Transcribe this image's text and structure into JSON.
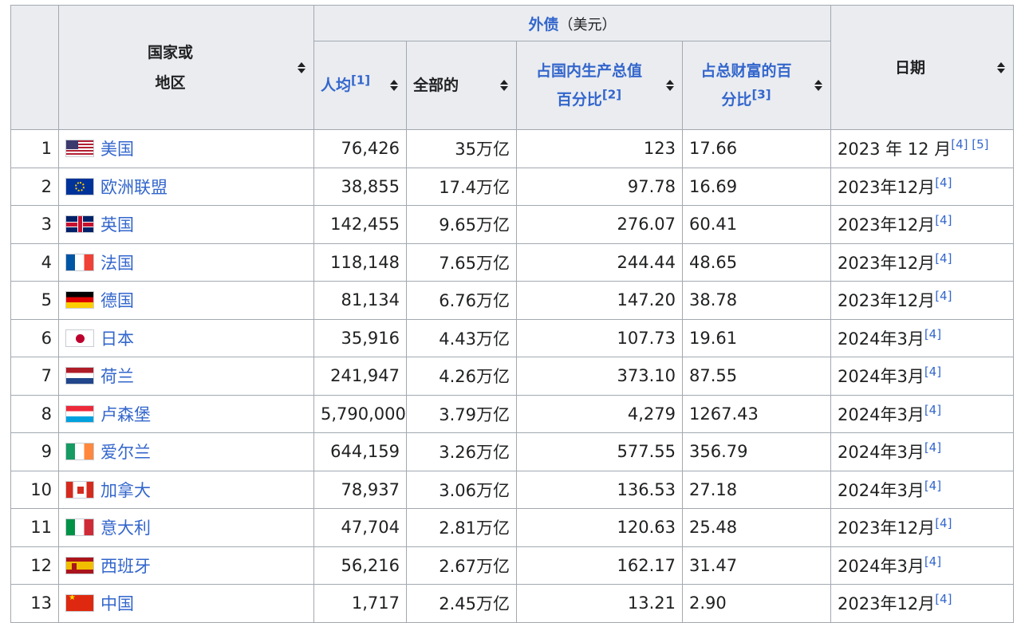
{
  "table": {
    "headers": {
      "country": "国家或\n地区",
      "country_line1": "国家或",
      "country_line2": "地区",
      "group_title": "外债",
      "group_unit": "（美元）",
      "per_capita": "人均",
      "per_capita_ref": "[1]",
      "total": "全部的",
      "gdp_pct_line1": "占国内生产总值",
      "gdp_pct_line2": "百分比",
      "gdp_pct_ref": "[2]",
      "wealth_pct_line1": "占总财富的百",
      "wealth_pct_line2": "分比",
      "wealth_pct_ref": "[3]",
      "date": "日期"
    },
    "rows": [
      {
        "rank": "1",
        "flag": "us-flag",
        "country": "美国",
        "per_capita": "76,426",
        "total": "35万亿",
        "gdp_pct": "123",
        "wealth_pct": "17.66",
        "date": "2023 年 12 月",
        "refs": "[4] [5]"
      },
      {
        "rank": "2",
        "flag": "eu-flag",
        "country": "欧洲联盟",
        "per_capita": "38,855",
        "total": "17.4万亿",
        "gdp_pct": "97.78",
        "wealth_pct": "16.69",
        "date": "2023年12月",
        "refs": "[4]"
      },
      {
        "rank": "3",
        "flag": "uk-flag",
        "country": "英国",
        "per_capita": "142,455",
        "total": "9.65万亿",
        "gdp_pct": "276.07",
        "wealth_pct": "60.41",
        "date": "2023年12月",
        "refs": "[4]"
      },
      {
        "rank": "4",
        "flag": "france-flag",
        "country": "法国",
        "per_capita": "118,148",
        "total": "7.65万亿",
        "gdp_pct": "244.44",
        "wealth_pct": "48.65",
        "date": "2023年12月",
        "refs": "[4]"
      },
      {
        "rank": "5",
        "flag": "germany-flag",
        "country": "德国",
        "per_capita": "81,134",
        "total": "6.76万亿",
        "gdp_pct": "147.20",
        "wealth_pct": "38.78",
        "date": "2023年12月",
        "refs": "[4]"
      },
      {
        "rank": "6",
        "flag": "japan-flag",
        "country": "日本",
        "per_capita": "35,916",
        "total": "4.43万亿",
        "gdp_pct": "107.73",
        "wealth_pct": "19.61",
        "date": "2024年3月",
        "refs": "[4]"
      },
      {
        "rank": "7",
        "flag": "netherlands-flag",
        "country": "荷兰",
        "per_capita": "241,947",
        "total": "4.26万亿",
        "gdp_pct": "373.10",
        "wealth_pct": "87.55",
        "date": "2024年3月",
        "refs": "[4]"
      },
      {
        "rank": "8",
        "flag": "luxembourg-flag",
        "country": "卢森堡",
        "per_capita": "5,790,000",
        "total": "3.79万亿",
        "gdp_pct": "4,279",
        "wealth_pct": "1267.43",
        "date": "2024年3月",
        "refs": "[4]"
      },
      {
        "rank": "9",
        "flag": "ireland-flag",
        "country": "爱尔兰",
        "per_capita": "644,159",
        "total": "3.26万亿",
        "gdp_pct": "577.55",
        "wealth_pct": "356.79",
        "date": "2024年3月",
        "refs": "[4]"
      },
      {
        "rank": "10",
        "flag": "canada-flag",
        "country": "加拿大",
        "per_capita": "78,937",
        "total": "3.06万亿",
        "gdp_pct": "136.53",
        "wealth_pct": "27.18",
        "date": "2024年3月",
        "refs": "[4]"
      },
      {
        "rank": "11",
        "flag": "italy-flag",
        "country": "意大利",
        "per_capita": "47,704",
        "total": "2.81万亿",
        "gdp_pct": "120.63",
        "wealth_pct": "25.48",
        "date": "2023年12月",
        "refs": "[4]"
      },
      {
        "rank": "12",
        "flag": "spain-flag",
        "country": "西班牙",
        "per_capita": "56,216",
        "total": "2.67万亿",
        "gdp_pct": "162.17",
        "wealth_pct": "31.47",
        "date": "2024年3月",
        "refs": "[4]"
      },
      {
        "rank": "13",
        "flag": "china-flag",
        "country": "中国",
        "per_capita": "1,717",
        "total": "2.45万亿",
        "gdp_pct": "13.21",
        "wealth_pct": "2.90",
        "date": "2023年12月",
        "refs": "[4]"
      }
    ]
  },
  "colors": {
    "link": "#3366cc",
    "header_bg": "#eaecf0",
    "border": "#a2a9b1",
    "text": "#202122"
  }
}
